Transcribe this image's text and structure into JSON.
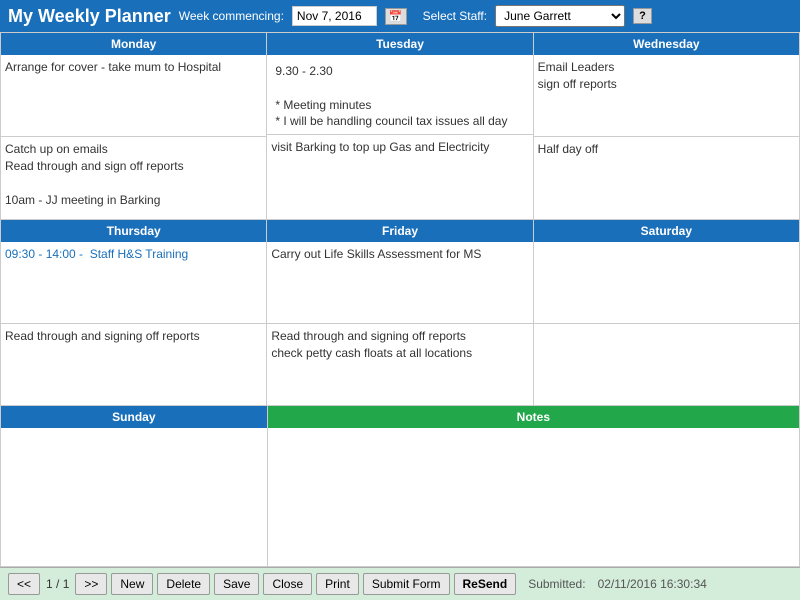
{
  "header": {
    "title": "My Weekly Planner",
    "week_label": "Week commencing:",
    "week_value": "Nov 7, 2016",
    "staff_label": "Select Staff:",
    "staff_value": "June  Garrett",
    "help_label": "?"
  },
  "days": {
    "monday": {
      "label": "Monday",
      "top_content": "Arrange for cover - take mum to Hospital",
      "bottom_content": "Catch up on emails\nRead through and sign off reports\n\n10am - JJ meeting in Barking"
    },
    "tuesday": {
      "label": "Tuesday",
      "top_scrollable": "9.30 - 2.30\n\n* Meeting minutes\n* I will be handling council tax issues all day",
      "bottom_content": "visit Barking to top up Gas and Electricity"
    },
    "wednesday": {
      "label": "Wednesday",
      "top_content": "Email Leaders\nsign off reports",
      "bottom_content": "Half day off"
    },
    "thursday": {
      "label": "Thursday",
      "top_content": "09:30 - 14:00 -  Staff H&S Training",
      "bottom_content": "Read through and signing off reports"
    },
    "friday": {
      "label": "Friday",
      "top_content": "Carry out Life Skills Assessment for MS",
      "bottom_content": "Read through and signing off reports\ncheck petty cash floats at all locations"
    },
    "saturday": {
      "label": "Saturday",
      "top_content": "",
      "bottom_content": ""
    },
    "sunday": {
      "label": "Sunday",
      "content": ""
    },
    "notes": {
      "label": "Notes",
      "content": ""
    }
  },
  "footer": {
    "prev_btn": "<<",
    "page_info": "1 / 1",
    "next_btn": ">>",
    "new_btn": "New",
    "delete_btn": "Delete",
    "save_btn": "Save",
    "close_btn": "Close",
    "print_btn": "Print",
    "submit_btn": "Submit Form",
    "resend_btn": "ReSend",
    "submitted_label": "Submitted:",
    "submitted_value": "02/11/2016 16:30:34"
  }
}
